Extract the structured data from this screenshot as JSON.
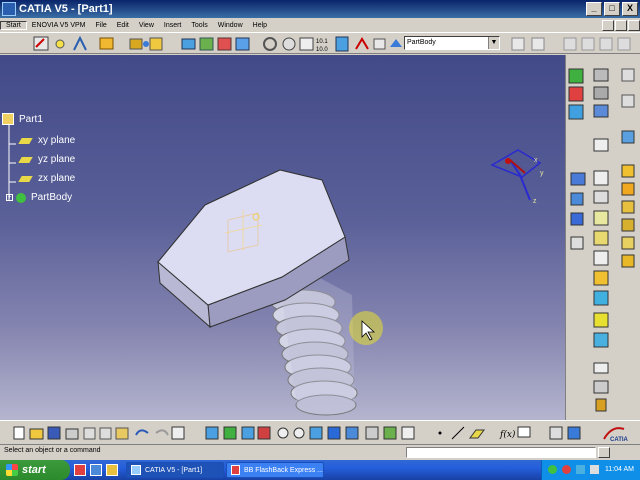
{
  "window": {
    "title": "CATIA V5 - [Part1]",
    "buttons": {
      "minimize": "_",
      "maximize": "□",
      "close": "X"
    }
  },
  "menu": {
    "items": [
      "Start",
      "ENOVIA V5 VPM",
      "File",
      "Edit",
      "View",
      "Insert",
      "Tools",
      "Window",
      "Help"
    ]
  },
  "toolbar": {
    "body_select": "PartBody",
    "measure_top": "10.1",
    "measure_bottom": "10.0"
  },
  "tree": {
    "root": "Part1",
    "items": [
      "xy plane",
      "yz plane",
      "zx plane",
      "PartBody"
    ]
  },
  "compass": {
    "x": "x",
    "y": "y",
    "z": "z"
  },
  "status": {
    "text": "Select an object or a command"
  },
  "taskbar": {
    "start_label": "start",
    "tasks": [
      "CATIA V5 - [Part1]",
      "BB FlashBack Express ..."
    ],
    "clock": "11:04 AM"
  },
  "colors": {
    "title_bar": "#0a246a",
    "viewport_top": "#424a88",
    "viewport_bottom": "#b5b5cf",
    "part_face": "#d8d8f0",
    "taskbar": "#245edc",
    "start_button": "#3c9a3c"
  },
  "icons": [
    "catia-logo-icon",
    "sketch-icon",
    "pad-icon",
    "pocket-icon",
    "hole-icon",
    "fillet-icon",
    "chamfer-icon",
    "zoom-in-icon",
    "zoom-out-icon",
    "pan-icon",
    "rotate-icon",
    "fit-all-icon",
    "normal-view-icon",
    "render-icon",
    "hide-show-icon",
    "swap-icon",
    "formula-icon",
    "knowledge-icon",
    "compass-icon"
  ]
}
